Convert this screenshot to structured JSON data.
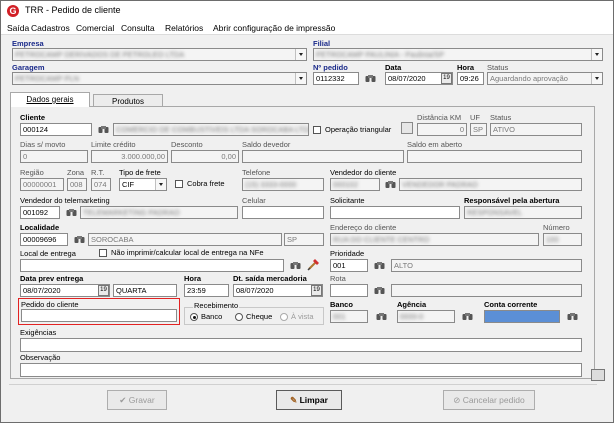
{
  "window": {
    "title": "TRR - Pedido de cliente",
    "logo_letter": "G"
  },
  "menu": [
    "Saída",
    "Cadastros",
    "Comercial",
    "Consulta",
    "Relatórios",
    "Abrir configuração de impressão"
  ],
  "header": {
    "empresa_label": "Empresa",
    "filial_label": "Filial",
    "garagem_label": "Garagem",
    "npedido_label": "Nº pedido",
    "npedido_value": "0112332",
    "data_label": "Data",
    "data_value": "08/07/2020",
    "hora_label": "Hora",
    "hora_value": "09:26",
    "status_label": "Status",
    "status_value": "Aguardando aprovação"
  },
  "tabs": [
    "Dados gerais",
    "Produtos"
  ],
  "form": {
    "cliente_label": "Cliente",
    "cliente_value": "000124",
    "operacao_triangular_label": "Operação triangular",
    "distancia_label": "Distância KM",
    "distancia_value": "0",
    "uf_label": "UF",
    "uf_value": "SP",
    "status_label": "Status",
    "status_value": "ATIVO",
    "dias_label": "Dias s/ movto",
    "dias_value": "0",
    "limite_label": "Limite crédito",
    "limite_value": "3.000.000,00",
    "desconto_label": "Desconto",
    "desconto_value": "0,00",
    "saldo_devedor_label": "Saldo devedor",
    "saldo_aberto_label": "Saldo em aberto",
    "regiao_label": "Região",
    "regiao_value": "00000001",
    "zona_label": "Zona",
    "zona_value": "008",
    "rt_label": "R.T.",
    "rt_value": "074",
    "tipo_frete_label": "Tipo de frete",
    "tipo_frete_value": "CIF",
    "cobra_frete_label": "Cobra frete",
    "telefone_label": "Telefone",
    "vendedor_label": "Vendedor do cliente",
    "vendedor_tele_label": "Vendedor do telemarketing",
    "vendedor_tele_value": "001092",
    "celular_label": "Celular",
    "solicitante_label": "Solicitante",
    "responsavel_label": "Responsável pela abertura",
    "localidade_label": "Localidade",
    "localidade_value": "00009696",
    "localidade_nome": "SOROCABA",
    "localidade_uf": "SP",
    "endereco_label": "Endereço do cliente",
    "numero_label": "Número",
    "local_entrega_label": "Local de entrega",
    "nao_imprimir_label": "Não imprimir/calcular local de entrega na NFe",
    "prioridade_label": "Prioridade",
    "prioridade_value": "001",
    "prioridade_nome": "ALTO",
    "data_prev_label": "Data prev entrega",
    "data_prev_value": "08/07/2020",
    "dia_semana": "QUARTA",
    "hora_label": "Hora",
    "hora_value": "23:59",
    "dt_saida_label": "Dt. saída mercadoria",
    "dt_saida_value": "08/07/2020",
    "rota_label": "Rota",
    "pedido_cliente_label": "Pedido do cliente",
    "recebimento_label": "Recebimento",
    "rec_banco": "Banco",
    "rec_cheque": "Cheque",
    "rec_avista": "À vista",
    "banco_label": "Banco",
    "agencia_label": "Agência",
    "conta_label": "Conta corrente",
    "exigencias_label": "Exigências",
    "observacao_label": "Observação"
  },
  "buttons": {
    "gravar": "Gravar",
    "limpar": "Limpar",
    "cancelar": "Cancelar pedido"
  },
  "colors": {
    "highlight": "#e32222",
    "accent": "#d21f26",
    "selected_blue": "#5b8fd6"
  }
}
